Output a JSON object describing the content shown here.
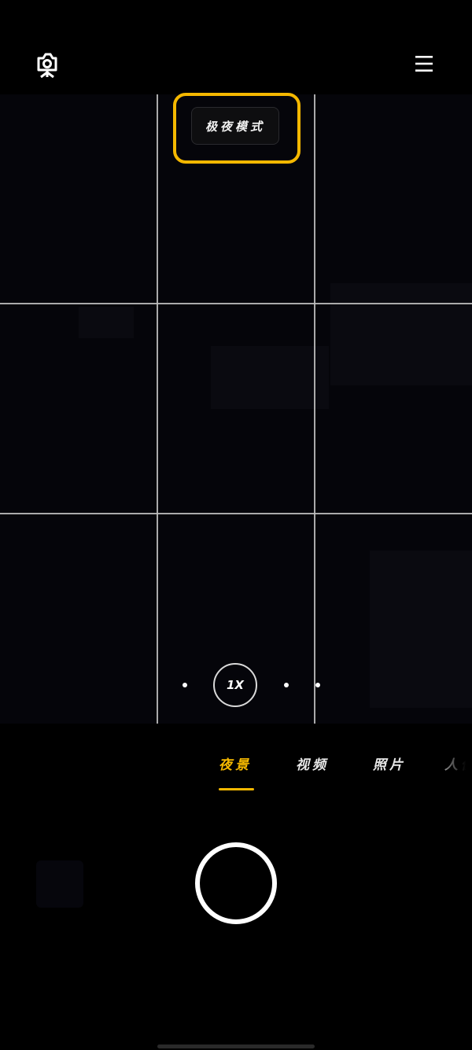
{
  "app": {
    "accent_color": "#f5b800"
  },
  "top_bar": {
    "left_icon": "camera-settings-icon",
    "right_icon": "menu-icon"
  },
  "viewfinder": {
    "grid": "3x3",
    "mode_chip_label": "极夜模式",
    "mode_chip_highlighted": true,
    "zoom_label": "1X"
  },
  "modes": {
    "items": [
      {
        "label": "夜景",
        "active": true
      },
      {
        "label": "视频",
        "active": false
      },
      {
        "label": "照片",
        "active": false
      },
      {
        "label": "人像",
        "active": false
      }
    ]
  },
  "controls": {
    "shutter_icon": "shutter-button",
    "gallery_icon": "gallery-thumbnail"
  }
}
